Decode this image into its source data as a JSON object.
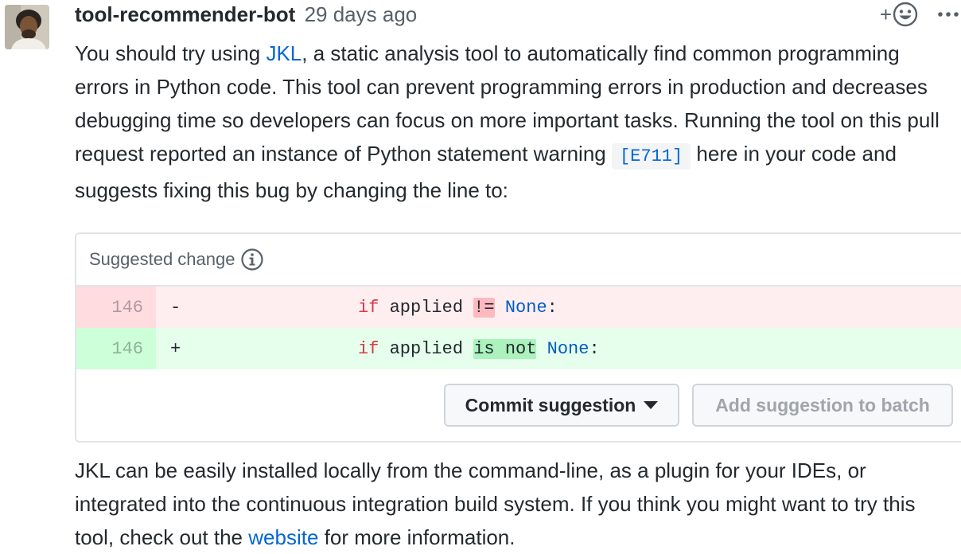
{
  "author": "tool-recommender-bot",
  "timestamp": "29 days ago",
  "actions": {
    "react_plus": "+",
    "more_icon": "kebab-horizontal-icon",
    "react_icon": "smiley-icon"
  },
  "intro": {
    "part1": "You should try using ",
    "tool_link": "JKL",
    "part2": ", a static analysis tool to automatically find common programming errors in Python code. This tool can prevent programming errors in production and decreases debugging time so developers can focus on more important tasks. Running the tool on this pull request reported an instance of Python statement warning ",
    "code": "[E711]",
    "part3": " here in your code and suggests fixing this bug by changing the line to:"
  },
  "suggestion": {
    "title": "Suggested change",
    "info_icon": "info-icon",
    "removed": {
      "line_no": "146",
      "marker": "-",
      "kw": "if",
      "ident": " applied ",
      "op": "!=",
      "const": "None",
      "tail": ":"
    },
    "added": {
      "line_no": "146",
      "marker": "+",
      "kw": "if",
      "ident": " applied ",
      "op": "is not",
      "const": "None",
      "tail": ":"
    },
    "commit_label": "Commit suggestion",
    "batch_label": "Add suggestion to batch"
  },
  "outro": {
    "part1": "JKL can be easily installed locally from the command-line, as a plugin for your IDEs, or integrated into the continuous integration build system. If you think you might want to try this tool, check out the ",
    "website_link": "website",
    "part2": " for more information."
  },
  "colors": {
    "link": "#0366d6",
    "del_bg": "#ffeef0",
    "add_bg": "#e6ffed",
    "keyword": "#d73a49",
    "constant": "#005cc5"
  }
}
